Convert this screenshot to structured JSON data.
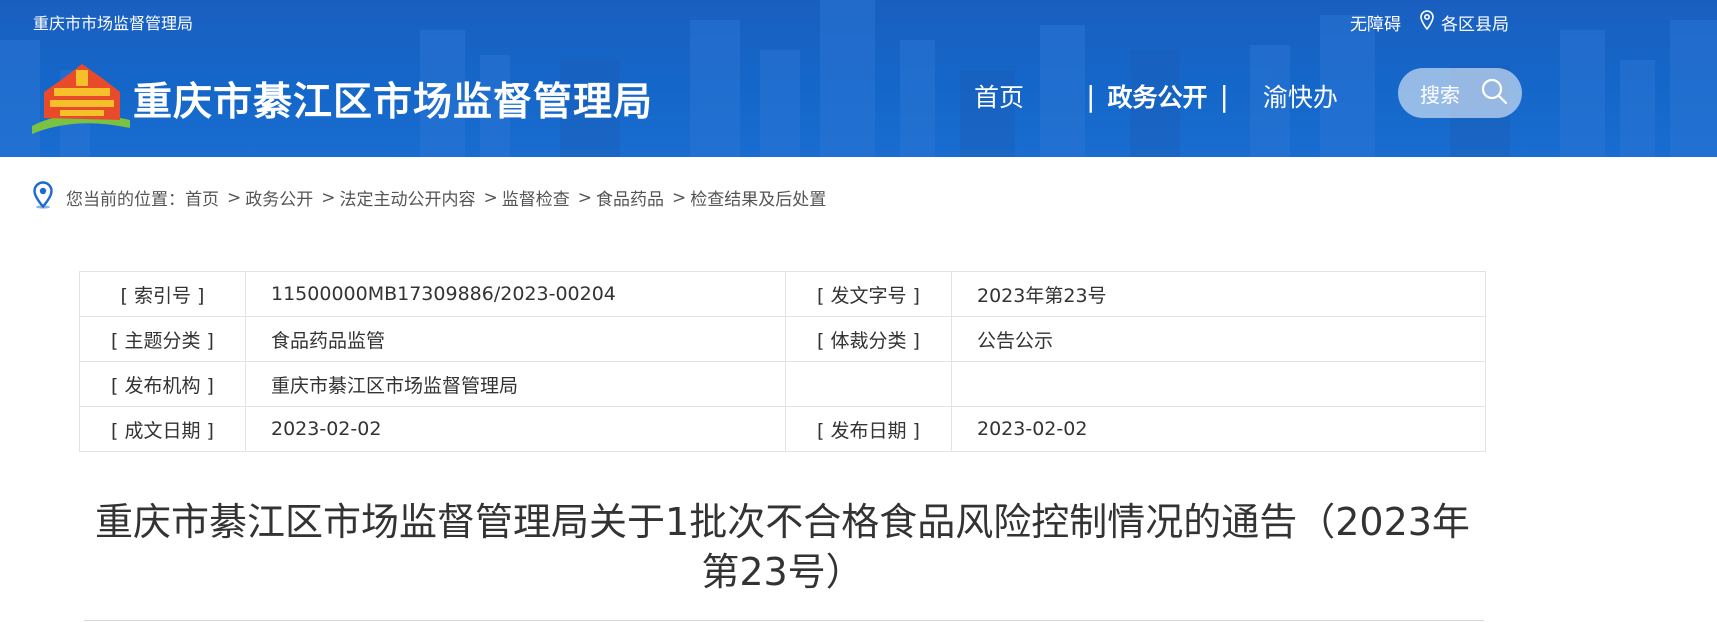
{
  "header": {
    "topbar_left": "重庆市市场监督管理局",
    "accessibility": "无障碍",
    "districts": "各区县局",
    "site_title": "重庆市綦江区市场监督管理局",
    "nav": {
      "home": "首页",
      "sep1": "|",
      "gov": "政务公开",
      "sep2": "|",
      "yu": "渝快办"
    },
    "search_label": "搜索",
    "colors": {
      "header_blue": "#1467c9"
    }
  },
  "breadcrumb": {
    "prefix": "您当前的位置：",
    "items": [
      "首页",
      "政务公开",
      "法定主动公开内容",
      "监督检查",
      "食品药品",
      "检查结果及后处置"
    ],
    "separator": ">"
  },
  "info_table": {
    "rows": [
      {
        "label1": "[ 索引号 ]",
        "value1": "11500000MB17309886/2023-00204",
        "label2": "[ 发文字号 ]",
        "value2": "2023年第23号"
      },
      {
        "label1": "[ 主题分类 ]",
        "value1": "食品药品监管",
        "label2": "[ 体裁分类 ]",
        "value2": "公告公示"
      },
      {
        "label1": "[ 发布机构 ]",
        "value1": "重庆市綦江区市场监督管理局",
        "label2": "",
        "value2": ""
      },
      {
        "label1": "[ 成文日期 ]",
        "value1": "2023-02-02",
        "label2": "[ 发布日期 ]",
        "value2": "2023-02-02"
      }
    ]
  },
  "article": {
    "title": "重庆市綦江区市场监督管理局关于1批次不合格食品风险控制情况的通告（2023年第23号）"
  }
}
